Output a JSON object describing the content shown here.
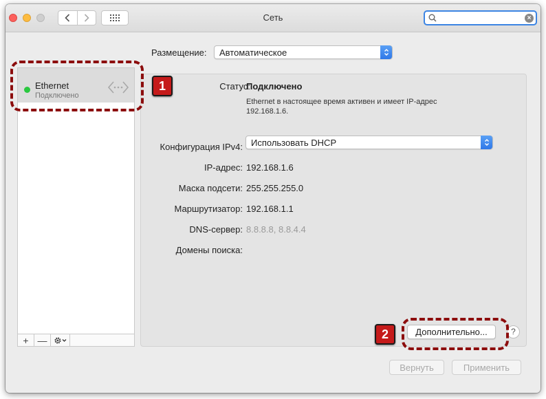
{
  "window": {
    "title": "Сеть",
    "nav_back_icon": "chevron-left-icon",
    "nav_forward_icon": "chevron-right-icon",
    "grid_icon": "show-all-grid-icon"
  },
  "search": {
    "value": "",
    "placeholder": ""
  },
  "location": {
    "label": "Размещение:",
    "value": "Автоматическое"
  },
  "sidebar": {
    "items": [
      {
        "name": "Ethernet",
        "status": "Подключено",
        "status_color": "#2bc840",
        "icon": "ethernet-icon"
      }
    ],
    "toolbar": {
      "add": "+",
      "remove": "—"
    }
  },
  "status": {
    "label": "Статус:",
    "value": "Подключено",
    "description": "Ethernet в настоящее время активен и имеет IP-адрес 192.168.1.6."
  },
  "config": {
    "ipv4_label": "Конфигурация IPv4:",
    "ipv4_value": "Использовать DHCP",
    "ip_label": "IP-адрес:",
    "ip_value": "192.168.1.6",
    "mask_label": "Маска подсети:",
    "mask_value": "255.255.255.0",
    "router_label": "Маршрутизатор:",
    "router_value": "192.168.1.1",
    "dns_label": "DNS-сервер:",
    "dns_value": "8.8.8.8, 8.8.4.4",
    "domains_label": "Домены поиска:",
    "domains_value": ""
  },
  "buttons": {
    "advanced": "Дополнительно...",
    "help": "?",
    "revert": "Вернуть",
    "apply": "Применить"
  },
  "annotations": {
    "badge_1": "1",
    "badge_2": "2",
    "color": "#c51a1a"
  }
}
